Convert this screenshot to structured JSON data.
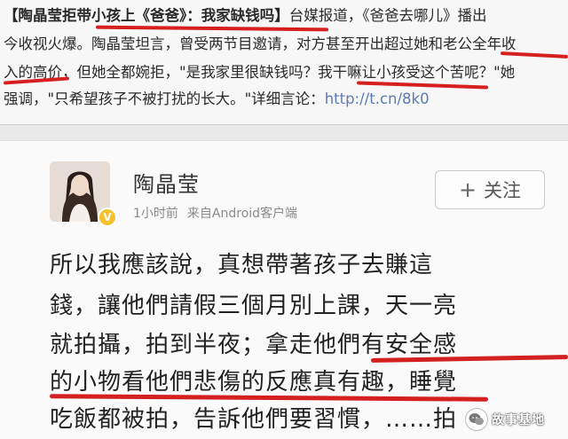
{
  "news": {
    "line1_headline": "【陶晶莹拒带小孩上《爸爸》：我家缺钱吗】",
    "line1_rest": "台媒报道，《爸爸去哪儿》播出",
    "line2": "今收视火爆。陶晶莹坦言，曾受两节目邀请，对方甚至开出超过她和老公全年收",
    "line3": "入的高价，但她全都婉拒，\"是我家里很缺钱吗？我干嘛让小孩受这个苦呢？\"她",
    "line4_text": "强调，\"只希望孩子不被打扰的长大。\"详细言论：",
    "line4_link": "http://t.cn/8k0"
  },
  "post": {
    "author": "陶晶莹",
    "verified_mark": "V",
    "time": "1小时前",
    "source": "来自Android客户端",
    "follow_plus": "+",
    "follow_label": "关注",
    "lines": [
      "所以我應該說，真想帶著孩子去賺這",
      "錢，讓他們請假三個月別上課，天一亮",
      "就拍攝，拍到半夜；拿走他們有安全感",
      "的小物看他們悲傷的反應真有趣，睡覺",
      "吃飯都被拍，告訴他們要習慣，……拍"
    ]
  },
  "watermark": {
    "text": "故事基地"
  },
  "colors": {
    "underline": "#d42020",
    "link": "#5b7bb5",
    "verified": "#f3c22c"
  }
}
